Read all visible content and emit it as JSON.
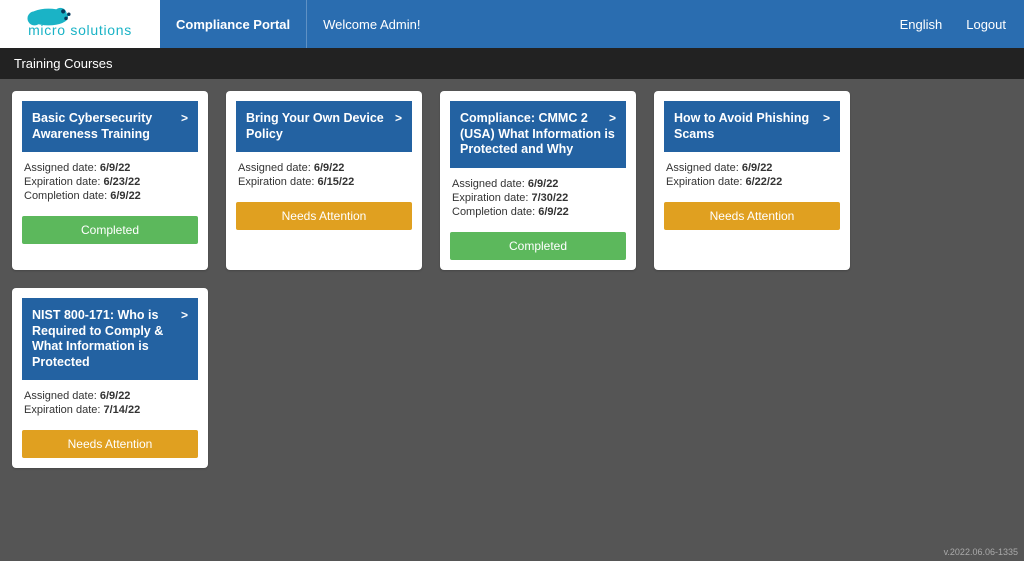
{
  "header": {
    "portal_label": "Compliance Portal",
    "welcome_label": "Welcome  Admin!",
    "language_label": "English",
    "logout_label": "Logout"
  },
  "section_title": "Training Courses",
  "labels": {
    "assigned": "Assigned date:",
    "expiration": "Expiration date:",
    "completion": "Completion date:"
  },
  "status_labels": {
    "completed": "Completed",
    "needs_attention": "Needs Attention"
  },
  "courses": [
    {
      "title": "Basic Cybersecurity Awareness Training",
      "assigned": "6/9/22",
      "expiration": "6/23/22",
      "completion": "6/9/22",
      "status": "completed"
    },
    {
      "title": "Bring Your Own Device Policy",
      "assigned": "6/9/22",
      "expiration": "6/15/22",
      "completion": null,
      "status": "needs_attention"
    },
    {
      "title": "Compliance: CMMC 2 (USA) What Information is Protected and Why",
      "assigned": "6/9/22",
      "expiration": "7/30/22",
      "completion": "6/9/22",
      "status": "completed"
    },
    {
      "title": "How to Avoid Phishing Scams",
      "assigned": "6/9/22",
      "expiration": "6/22/22",
      "completion": null,
      "status": "needs_attention"
    },
    {
      "title": "NIST 800-171: Who is Required to Comply & What Information is Protected",
      "assigned": "6/9/22",
      "expiration": "7/14/22",
      "completion": null,
      "status": "needs_attention"
    }
  ],
  "footer_version": "v.2022.06.06-1335",
  "brand": {
    "name": "micro solutions",
    "accent": "#1ab3c6"
  }
}
